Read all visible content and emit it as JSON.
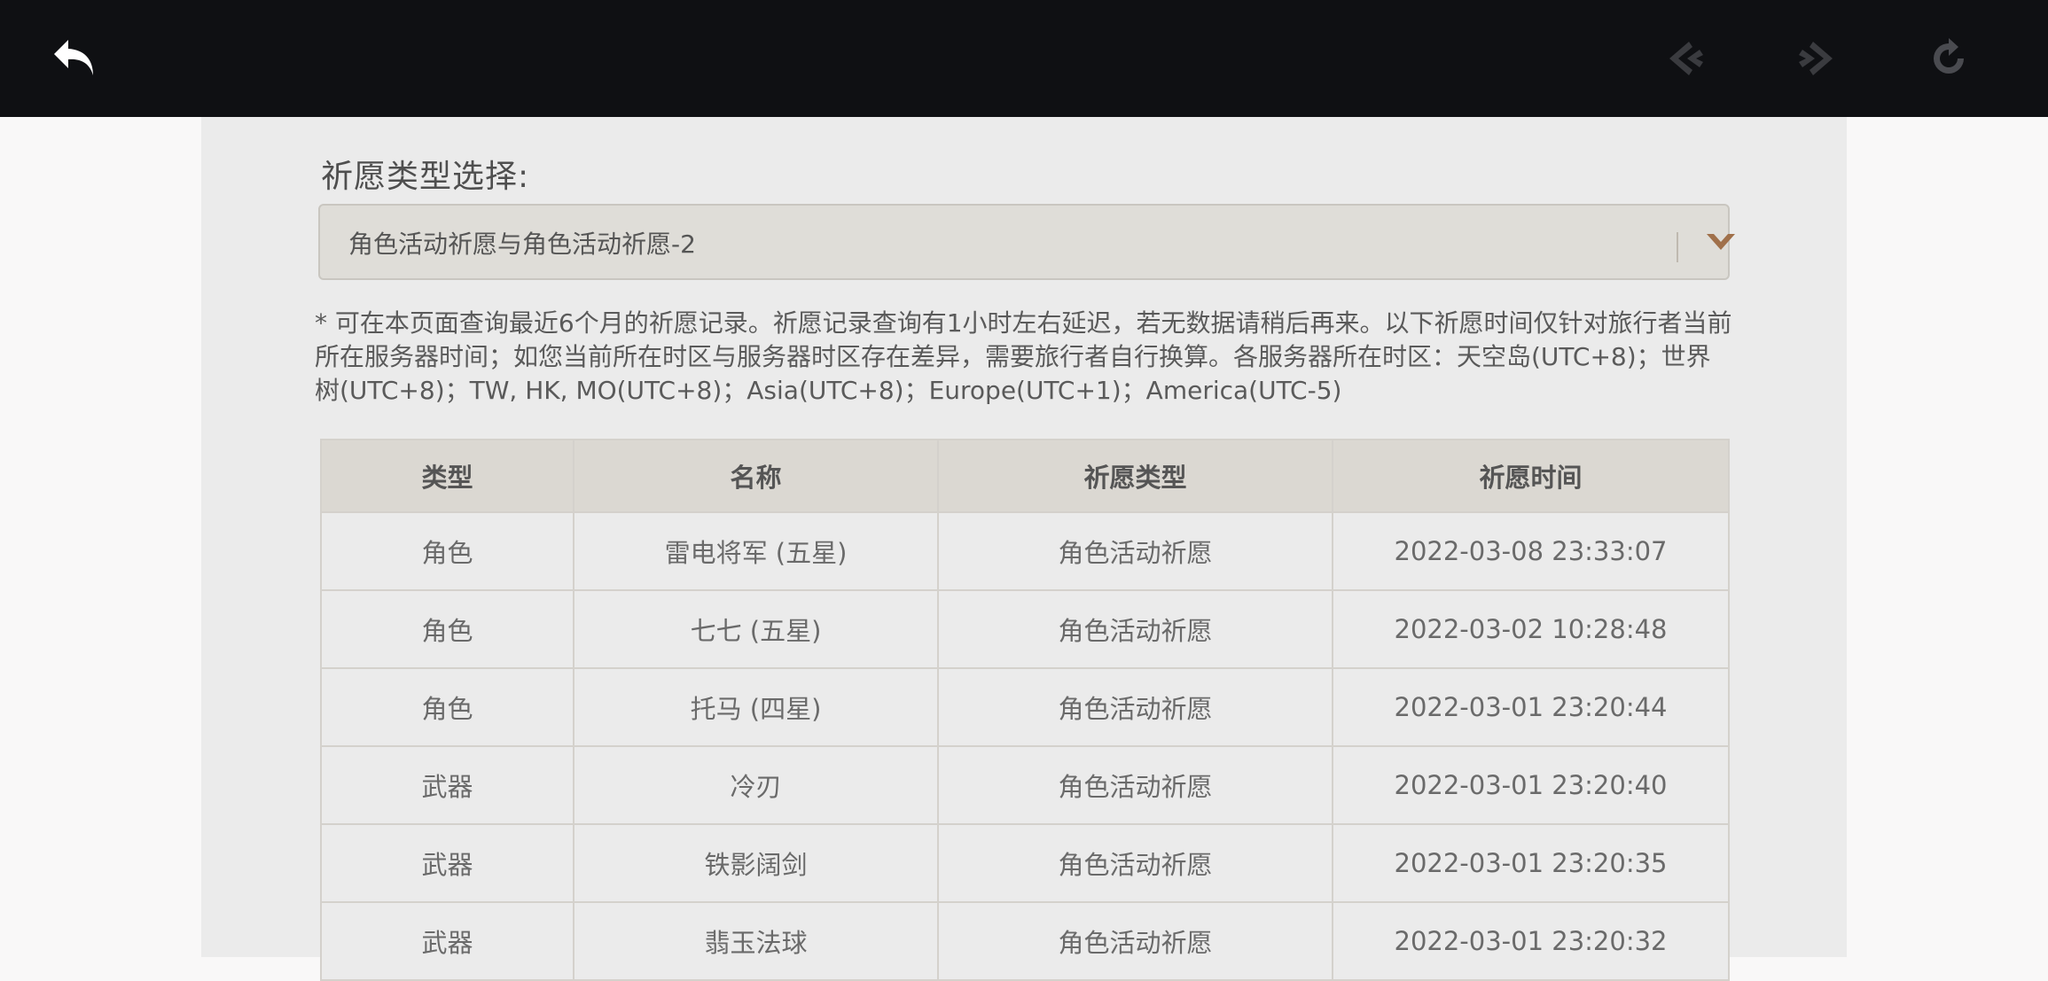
{
  "colors": {
    "topbar": "#0f1013",
    "five_star": "#c0622a",
    "four_star": "#9b48d6",
    "dropdown_caret": "#a0704a"
  },
  "topbar": {
    "icons": [
      "back-arrow-icon",
      "prev-arrow-icon",
      "next-arrow-icon",
      "refresh-icon"
    ]
  },
  "filter": {
    "label": "祈愿类型选择:",
    "selected": "角色活动祈愿与角色活动祈愿-2"
  },
  "notice": "* 可在本页面查询最近6个月的祈愿记录。祈愿记录查询有1小时左右延迟，若无数据请稍后再来。以下祈愿时间仅针对旅行者当前所在服务器时间；如您当前所在时区与服务器时区存在差异，需要旅行者自行换算。各服务器所在时区：天空岛(UTC+8)；世界树(UTC+8)；TW, HK, MO(UTC+8)；Asia(UTC+8)；Europe(UTC+1)；America(UTC-5)",
  "table": {
    "headers": [
      "类型",
      "名称",
      "祈愿类型",
      "祈愿时间"
    ],
    "rows": [
      {
        "type": "角色",
        "name": "雷电将军 (五星)",
        "rarity": "five",
        "wish": "角色活动祈愿",
        "time": "2022-03-08 23:33:07"
      },
      {
        "type": "角色",
        "name": "七七 (五星)",
        "rarity": "five",
        "wish": "角色活动祈愿",
        "time": "2022-03-02 10:28:48"
      },
      {
        "type": "角色",
        "name": "托马 (四星)",
        "rarity": "four",
        "wish": "角色活动祈愿",
        "time": "2022-03-01 23:20:44"
      },
      {
        "type": "武器",
        "name": "冷刃",
        "rarity": "three",
        "wish": "角色活动祈愿",
        "time": "2022-03-01 23:20:40"
      },
      {
        "type": "武器",
        "name": "铁影阔剑",
        "rarity": "three",
        "wish": "角色活动祈愿",
        "time": "2022-03-01 23:20:35"
      },
      {
        "type": "武器",
        "name": "翡玉法球",
        "rarity": "three",
        "wish": "角色活动祈愿",
        "time": "2022-03-01 23:20:32"
      }
    ]
  }
}
